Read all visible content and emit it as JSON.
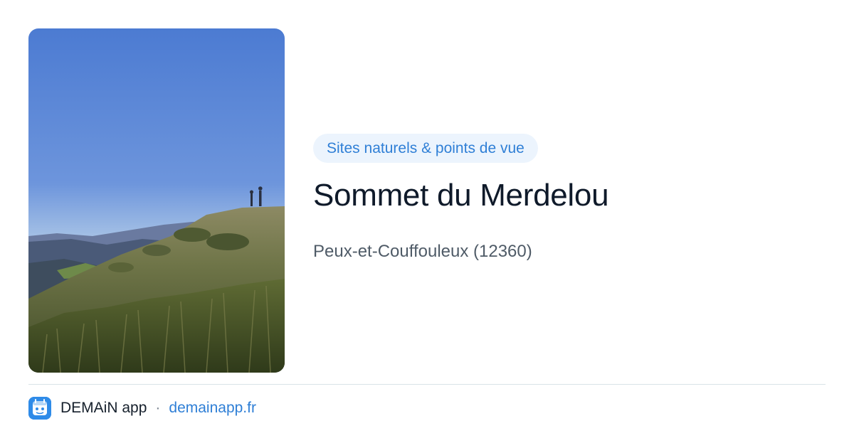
{
  "card": {
    "category": "Sites naturels & points de vue",
    "title": "Sommet du Merdelou",
    "location": "Peux-et-Couffouleux (12360)"
  },
  "photo": {
    "subject": "mountain-summit-photo",
    "colors": {
      "sky_top": "#4f7ed4",
      "sky_bottom": "#a9c4e6",
      "mountains": "#4a5a78",
      "grass": "#5d6a3a"
    }
  },
  "footer": {
    "app_name": "DEMAiN app",
    "separator": "·",
    "url": "demainapp.fr",
    "icon": "demain-app-icon"
  },
  "colors": {
    "accent": "#2f7fd6",
    "pill_background": "#ecf4fd",
    "title": "#0f1a2a",
    "subtitle": "#4f5b67",
    "divider": "#d9e3e8"
  }
}
